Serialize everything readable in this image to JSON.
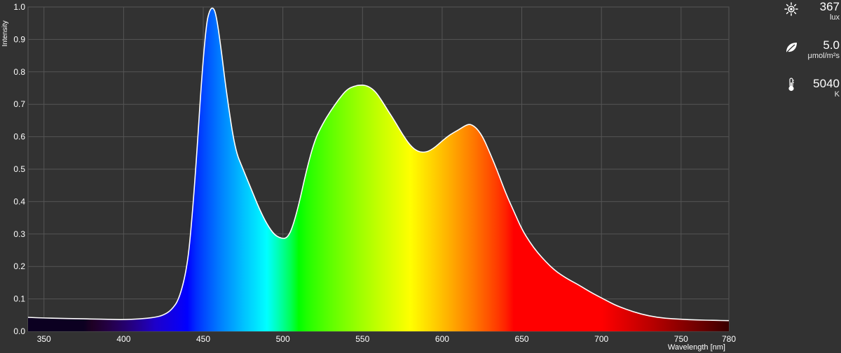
{
  "chart_data": {
    "type": "area",
    "xlabel": "Wavelength [nm]",
    "ylabel": "Intensity",
    "xlim": [
      340,
      780
    ],
    "ylim": [
      0,
      1.0
    ],
    "x_ticks": [
      350,
      400,
      450,
      500,
      550,
      600,
      650,
      700,
      750,
      780
    ],
    "y_ticks": [
      "0.0",
      "0.1",
      "0.2",
      "0.3",
      "0.4",
      "0.5",
      "0.6",
      "0.7",
      "0.8",
      "0.9",
      "1.0"
    ],
    "grid": true,
    "series": [
      {
        "x": [
          340,
          350,
          360,
          370,
          380,
          390,
          400,
          410,
          420,
          425,
          430,
          435,
          440,
          443,
          446,
          449,
          452,
          454,
          456,
          458,
          461,
          465,
          470,
          475,
          480,
          485,
          490,
          495,
          500,
          503,
          506,
          510,
          515,
          520,
          525,
          530,
          535,
          540,
          545,
          550,
          554,
          558,
          562,
          566,
          570,
          575,
          580,
          585,
          590,
          595,
          600,
          605,
          610,
          615,
          618,
          622,
          626,
          630,
          635,
          640,
          645,
          650,
          655,
          660,
          665,
          670,
          675,
          680,
          685,
          690,
          695,
          700,
          705,
          710,
          720,
          730,
          740,
          750,
          760,
          770,
          780
        ],
        "values": [
          0.043,
          0.041,
          0.04,
          0.039,
          0.038,
          0.037,
          0.036,
          0.038,
          0.043,
          0.05,
          0.065,
          0.1,
          0.2,
          0.35,
          0.55,
          0.78,
          0.95,
          0.99,
          1.0,
          0.98,
          0.88,
          0.72,
          0.56,
          0.5,
          0.44,
          0.38,
          0.33,
          0.295,
          0.285,
          0.29,
          0.32,
          0.39,
          0.5,
          0.59,
          0.64,
          0.68,
          0.715,
          0.745,
          0.757,
          0.76,
          0.755,
          0.74,
          0.712,
          0.68,
          0.65,
          0.608,
          0.572,
          0.553,
          0.552,
          0.565,
          0.587,
          0.607,
          0.62,
          0.636,
          0.639,
          0.625,
          0.595,
          0.55,
          0.49,
          0.425,
          0.37,
          0.315,
          0.275,
          0.242,
          0.215,
          0.191,
          0.173,
          0.158,
          0.145,
          0.13,
          0.116,
          0.103,
          0.09,
          0.078,
          0.06,
          0.047,
          0.04,
          0.037,
          0.035,
          0.034,
          0.033
        ]
      }
    ]
  },
  "readouts": {
    "lux": {
      "icon": "sun-icon",
      "value": "367",
      "unit": "lux"
    },
    "ppfd": {
      "icon": "leaf-icon",
      "value": "5.0",
      "unit": "μmol/m²s"
    },
    "cct": {
      "icon": "thermometer-icon",
      "value": "5040",
      "unit": "K"
    }
  }
}
